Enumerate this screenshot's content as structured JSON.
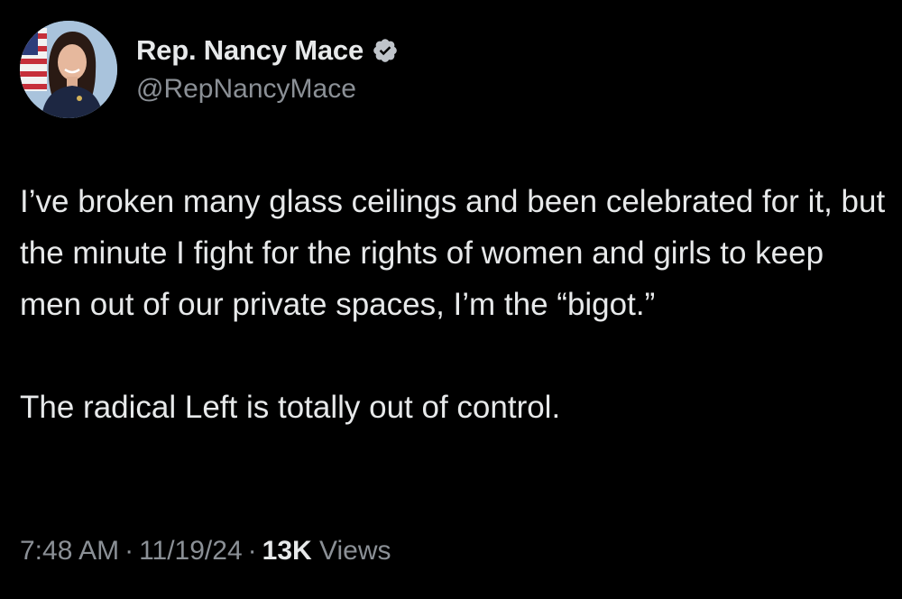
{
  "colors": {
    "background": "#000000",
    "text_primary": "#e7e9ea",
    "text_secondary": "#8b9096",
    "verified_badge": "#bfc4ca"
  },
  "author": {
    "display_name": "Rep. Nancy Mace",
    "handle": "@RepNancyMace",
    "avatar_icon": "profile-photo",
    "verified_icon": "verified-badge-icon"
  },
  "tweet": {
    "paragraphs": [
      "I’ve broken many glass ceilings and been celebrated for it, but the minute I fight for the rights of women and girls to keep men out of our private spaces, I’m the “bigot.”",
      "The radical Left is totally out of control."
    ]
  },
  "meta": {
    "time": "7:48 AM",
    "separator": "·",
    "date": "11/19/24",
    "views_count": "13K",
    "views_label": "Views"
  }
}
